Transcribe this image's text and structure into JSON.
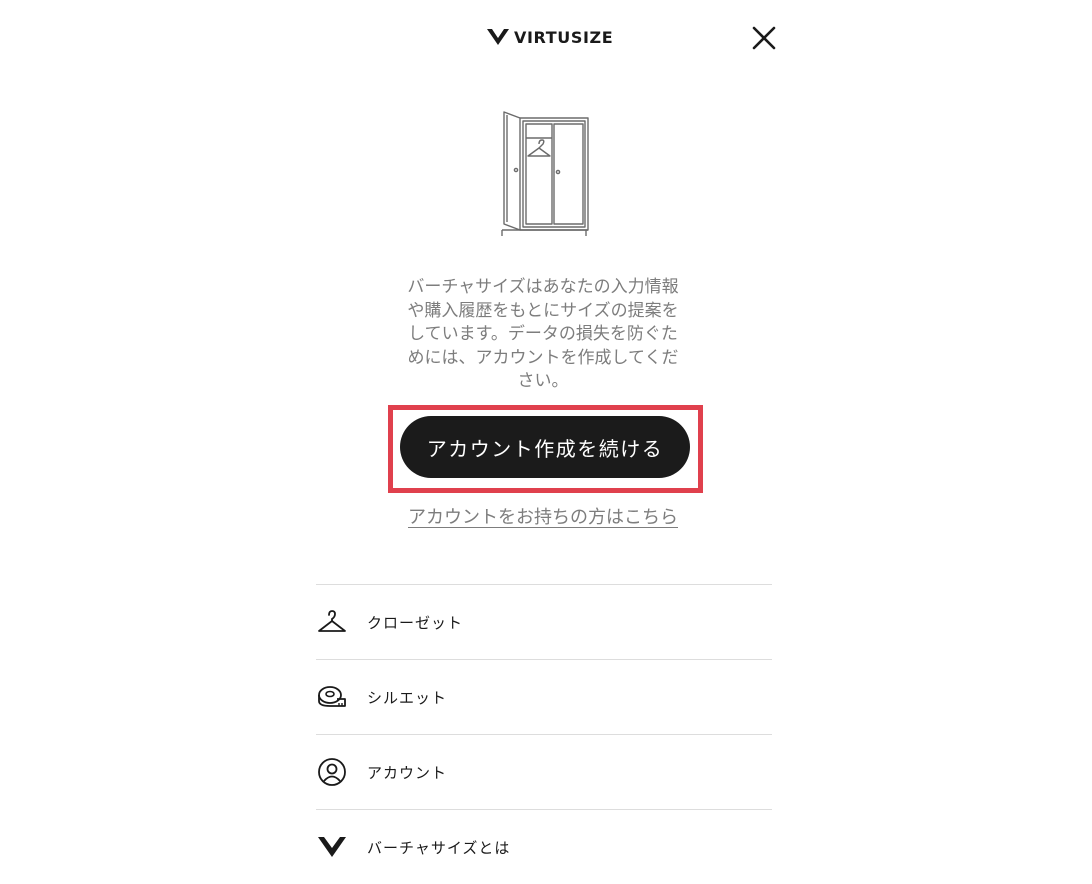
{
  "header": {
    "brand": "VIRTUSIZE"
  },
  "main": {
    "description_lines": [
      "バーチャサイズはあなたの入力情報",
      "や購入履歴をもとにサイズの提案を",
      "しています。データの損失を防ぐた",
      "めには、アカウントを作成してくだ",
      "さい。"
    ],
    "cta_label": "アカウント作成を続ける",
    "login_link": "アカウントをお持ちの方はこちら"
  },
  "menu": {
    "items": [
      {
        "label": "クローゼット",
        "icon": "hanger-icon"
      },
      {
        "label": "シルエット",
        "icon": "measuring-tape-icon"
      },
      {
        "label": "アカウント",
        "icon": "account-icon"
      },
      {
        "label": "バーチャサイズとは",
        "icon": "virtusize-logo-icon"
      }
    ]
  },
  "colors": {
    "button_bg": "#1b1b1b",
    "highlight_border": "#e0404d",
    "muted_text": "#7d7d7d",
    "divider": "#dddddd"
  }
}
